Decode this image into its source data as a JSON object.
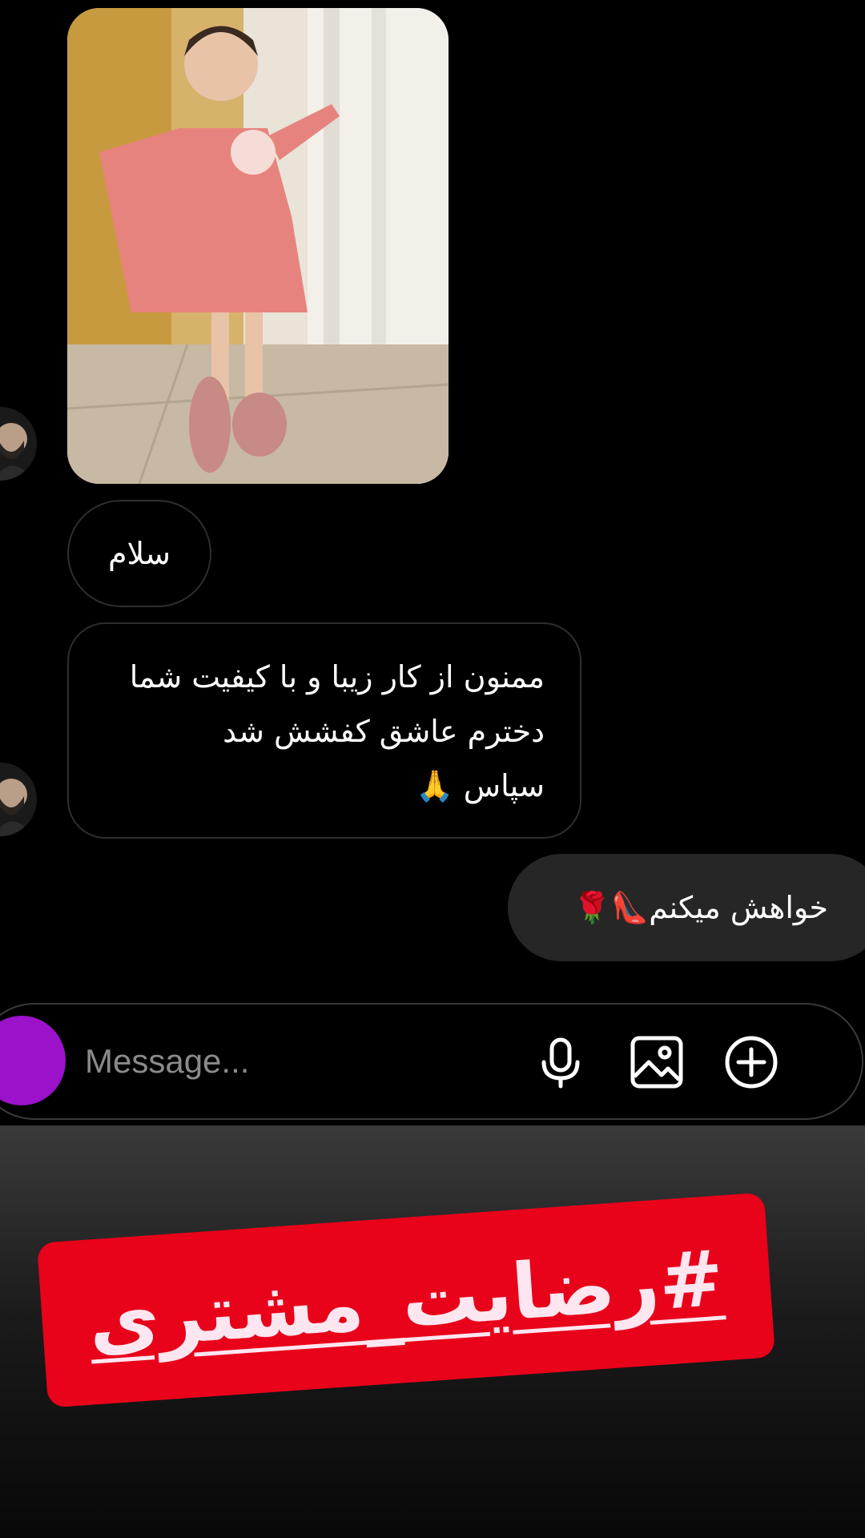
{
  "chat": {
    "messages": [
      {
        "side": "incoming",
        "type": "image",
        "alt": "photo"
      },
      {
        "side": "incoming",
        "type": "text",
        "text": "سلام"
      },
      {
        "side": "incoming",
        "type": "text",
        "lines": [
          "ممنون از کار زیبا و با کیفیت شما",
          "دخترم عاشق کفشش شد",
          "سپاس 🙏"
        ]
      },
      {
        "side": "outgoing",
        "type": "text",
        "text": "خواهش میکنم👠🌹"
      }
    ]
  },
  "composer": {
    "placeholder": "Message...",
    "icons": [
      "camera-icon",
      "microphone-icon",
      "gallery-icon",
      "plus-circle-icon"
    ],
    "camera_color": "#9a12c9"
  },
  "promo": {
    "hashtag": "#رضایت_مشتری",
    "banner_color": "#e8021a",
    "text_color": "#fde6f0"
  }
}
